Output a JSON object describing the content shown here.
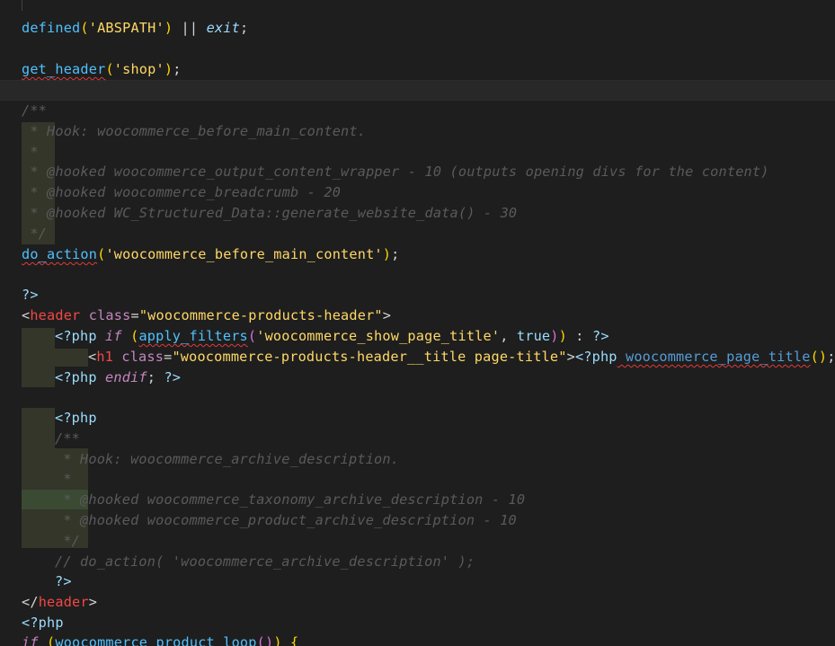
{
  "editor": {
    "colors": {
      "background": "#1e1e1e",
      "function": "#4fc1ff",
      "string": "#ffd866",
      "comment": "#5a5a5a",
      "keyword": "#c586c0",
      "tag": "#f44747"
    },
    "lines": {
      "l1": {
        "a": "defined",
        "b": "(",
        "c": "'ABSPATH'",
        "d": ")",
        "e": " || ",
        "f": "exit",
        "g": ";"
      },
      "l2": {
        "a": "get_header",
        "b": "(",
        "c": "'shop'",
        "d": ")",
        "e": ";"
      },
      "c1": {
        "a": "/**"
      },
      "c2": {
        "a": " * Hook: woocommerce_before_main_content."
      },
      "c3": {
        "a": " *"
      },
      "c4": {
        "a": " * @hooked woocommerce_output_content_wrapper - 10 (outputs opening divs for the content)"
      },
      "c5": {
        "a": " * @hooked woocommerce_breadcrumb - 20"
      },
      "c6": {
        "a": " * @hooked WC_Structured_Data::generate_website_data() - 30"
      },
      "c7": {
        "a": " */"
      },
      "l3": {
        "a": "do_action",
        "b": "(",
        "c": "'woocommerce_before_main_content'",
        "d": ")",
        "e": ";"
      },
      "l4": {
        "a": "?>"
      },
      "l5": {
        "a": "<",
        "b": "header",
        "c": " class",
        "d": "=",
        "e": "\"woocommerce-products-header\"",
        "f": ">"
      },
      "l6": {
        "a": "<?php",
        "b": " if",
        "c": " (",
        "d": "apply_filters",
        "e": "(",
        "f": "'woocommerce_show_page_title'",
        "g": ", ",
        "h": "true",
        "i": ")",
        "j": ")",
        "k": " : ",
        "l": "?>"
      },
      "l7": {
        "a": "<",
        "b": "h1",
        "c": " class",
        "d": "=",
        "e": "\"woocommerce-products-header__title page-title\"",
        "f": ">",
        "g": "<?php",
        "h": " woocommerce_page_title",
        "i": "()",
        "j": ";"
      },
      "l8": {
        "a": "<?php",
        "b": " endif",
        "c": "; ",
        "d": "?>"
      },
      "l9": {
        "a": "<?php"
      },
      "d1": {
        "a": "/**"
      },
      "d2": {
        "a": " * Hook: woocommerce_archive_description."
      },
      "d3": {
        "a": " *"
      },
      "d4": {
        "a": " * @hooked woocommerce_taxonomy_archive_description - 10"
      },
      "d5": {
        "a": " * @hooked woocommerce_product_archive_description - 10"
      },
      "d6": {
        "a": " */"
      },
      "d7": {
        "a": "// do_action( 'woocommerce_archive_description' );"
      },
      "l10": {
        "a": "?>"
      },
      "l11": {
        "a": "</",
        "b": "header",
        "c": ">"
      },
      "l12": {
        "a": "<?php"
      },
      "l13": {
        "a": "if",
        "b": " (",
        "c": "woocommerce_product_loop",
        "d": "()",
        "e": ")",
        "f": " {"
      }
    }
  }
}
